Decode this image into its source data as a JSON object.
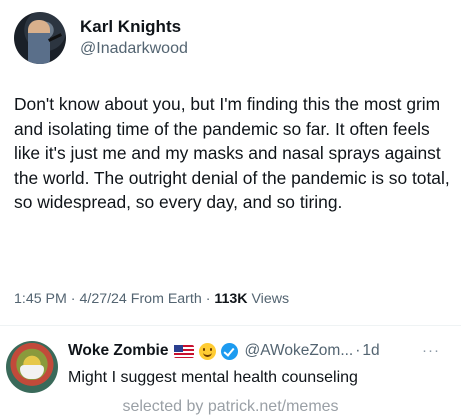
{
  "tweet": {
    "display_name": "Karl Knights",
    "handle": "@Inadarkwood",
    "text": "Don't know about you, but I'm finding this the most grim and isolating time of the pandemic so far. It often feels like it's just me and my masks and nasal sprays against the world. The outright denial of the pandemic is so total, so widespread, so every day, and so tiring.",
    "time": "1:45 PM",
    "date": "4/27/24",
    "source": "From Earth",
    "views_count": "113K",
    "views_label": "Views",
    "separator": "·"
  },
  "reply": {
    "display_name": "Woke Zombie",
    "handle": "@AWokeZom...",
    "separator": "·",
    "time": "1d",
    "text": "Might I suggest mental health counseling",
    "icons": [
      "us-flag-icon",
      "smile-icon",
      "verified-icon"
    ],
    "more_label": "···"
  },
  "watermark": "selected by patrick.net/memes",
  "colors": {
    "text_primary": "#0f1419",
    "text_secondary": "#536471",
    "verified": "#1d9bf0",
    "divider": "#eff3f4"
  }
}
